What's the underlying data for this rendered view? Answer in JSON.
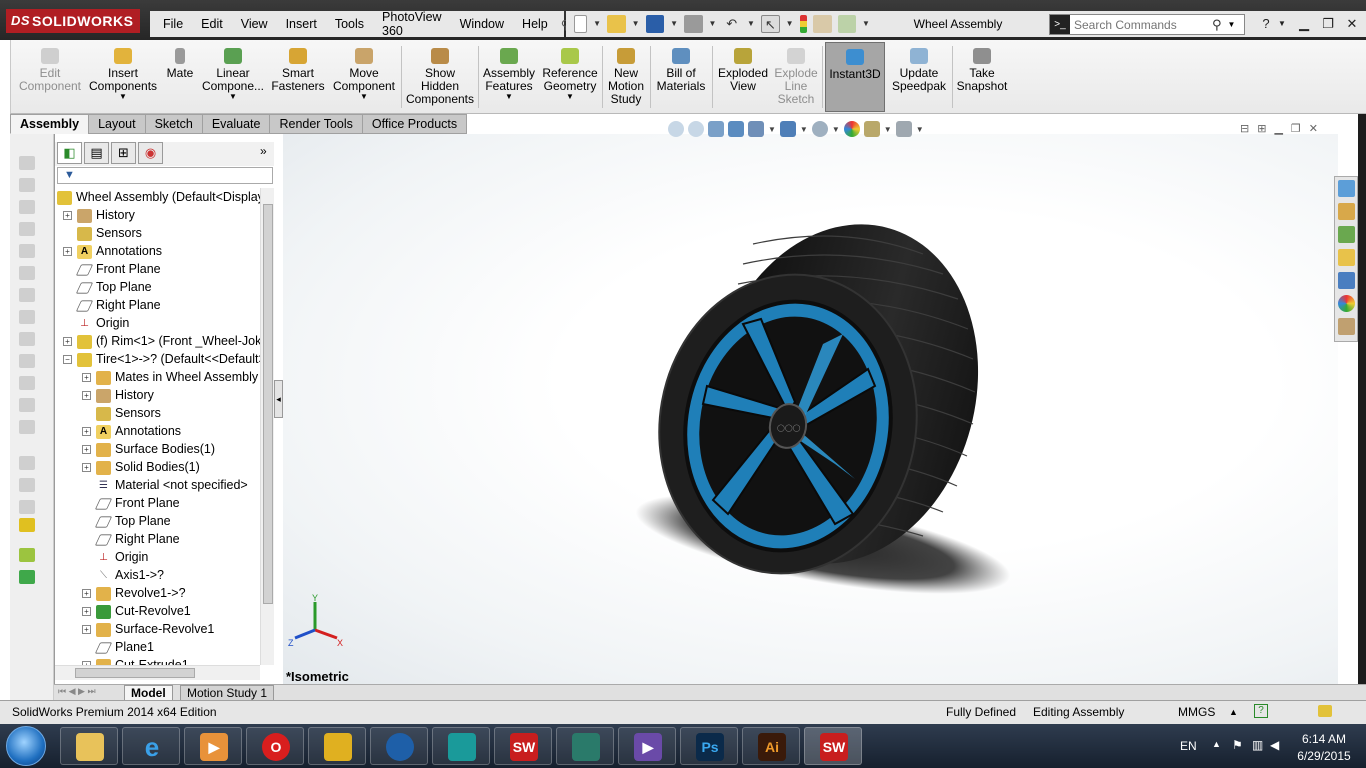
{
  "app": {
    "logo": "SOLIDWORKS",
    "logo_ds": "DS",
    "window_title": "Wheel Assembly"
  },
  "menu": [
    "File",
    "Edit",
    "View",
    "Insert",
    "Tools",
    "PhotoView 360",
    "Window",
    "Help"
  ],
  "search": {
    "placeholder": "Search Commands"
  },
  "toolbar": {
    "commands": [
      {
        "label": "Edit\nComponent",
        "disabled": true
      },
      {
        "label": "Insert\nComponents",
        "disabled": false
      },
      {
        "label": "Mate",
        "disabled": false
      },
      {
        "label": "Linear\nCompone...",
        "disabled": false
      },
      {
        "label": "Smart\nFasteners",
        "disabled": false
      },
      {
        "label": "Move\nComponent",
        "disabled": false
      },
      {
        "label": "Show\nHidden\nComponents",
        "disabled": false
      },
      {
        "label": "Assembly\nFeatures",
        "disabled": false
      },
      {
        "label": "Reference\nGeometry",
        "disabled": false
      },
      {
        "label": "New\nMotion\nStudy",
        "disabled": false
      },
      {
        "label": "Bill of\nMaterials",
        "disabled": false
      },
      {
        "label": "Exploded\nView",
        "disabled": false
      },
      {
        "label": "Explode\nLine\nSketch",
        "disabled": true
      },
      {
        "label": "Instant3D",
        "disabled": false,
        "active": true
      },
      {
        "label": "Update\nSpeedpak",
        "disabled": false
      },
      {
        "label": "Take\nSnapshot",
        "disabled": false
      }
    ]
  },
  "tabs": [
    "Assembly",
    "Layout",
    "Sketch",
    "Evaluate",
    "Render Tools",
    "Office Products"
  ],
  "feature_tree": {
    "root": "Wheel Assembly  (Default<Display",
    "items": [
      {
        "label": "History",
        "level": 1,
        "expandable": true
      },
      {
        "label": "Sensors",
        "level": 1,
        "expandable": false
      },
      {
        "label": "Annotations",
        "level": 1,
        "expandable": true
      },
      {
        "label": "Front Plane",
        "level": 1,
        "expandable": false
      },
      {
        "label": "Top Plane",
        "level": 1,
        "expandable": false
      },
      {
        "label": "Right Plane",
        "level": 1,
        "expandable": false
      },
      {
        "label": "Origin",
        "level": 1,
        "expandable": false
      },
      {
        "label": "(f) Rim<1> (Front _Wheel-Joke",
        "level": 1,
        "expandable": true
      },
      {
        "label": "Tire<1>->? (Default<<Default>",
        "level": 1,
        "expandable": true,
        "expanded": true
      },
      {
        "label": "Mates in Wheel Assembly",
        "level": 2,
        "expandable": true
      },
      {
        "label": "History",
        "level": 2,
        "expandable": true
      },
      {
        "label": "Sensors",
        "level": 2,
        "expandable": false
      },
      {
        "label": "Annotations",
        "level": 2,
        "expandable": true
      },
      {
        "label": "Surface Bodies(1)",
        "level": 2,
        "expandable": true
      },
      {
        "label": "Solid Bodies(1)",
        "level": 2,
        "expandable": true
      },
      {
        "label": "Material <not specified>",
        "level": 2,
        "expandable": false
      },
      {
        "label": "Front Plane",
        "level": 2,
        "expandable": false
      },
      {
        "label": "Top Plane",
        "level": 2,
        "expandable": false
      },
      {
        "label": "Right Plane",
        "level": 2,
        "expandable": false
      },
      {
        "label": "Origin",
        "level": 2,
        "expandable": false
      },
      {
        "label": "Axis1->?",
        "level": 2,
        "expandable": false
      },
      {
        "label": "Revolve1->?",
        "level": 2,
        "expandable": true
      },
      {
        "label": "Cut-Revolve1",
        "level": 2,
        "expandable": true
      },
      {
        "label": "Surface-Revolve1",
        "level": 2,
        "expandable": true
      },
      {
        "label": "Plane1",
        "level": 2,
        "expandable": false
      },
      {
        "label": "Cut-Extrude1",
        "level": 2,
        "expandable": true
      }
    ]
  },
  "model_tabs": [
    "Model",
    "Motion Study 1"
  ],
  "viewport": {
    "view_name": "*Isometric",
    "triad": {
      "x": "X",
      "y": "Y",
      "z": "Z"
    },
    "rim_color": "#1f7fb8",
    "tire_color": "#1b1b1b"
  },
  "status": {
    "edition": "SolidWorks Premium 2014 x64 Edition",
    "definition": "Fully Defined",
    "mode": "Editing Assembly",
    "units": "MMGS"
  },
  "taskbar": {
    "apps": [
      "explorer",
      "internet-explorer",
      "media-player",
      "opera",
      "bandicam",
      "camera-app",
      "3ds-max",
      "solidworks",
      "illustrator-alt",
      "visual-studio",
      "photoshop",
      "illustrator",
      "solidworks-active"
    ],
    "ps_label": "Ps",
    "ai_label": "Ai",
    "sw_label": "SW",
    "lang": "EN",
    "time": "6:14 AM",
    "date": "6/29/2015"
  }
}
